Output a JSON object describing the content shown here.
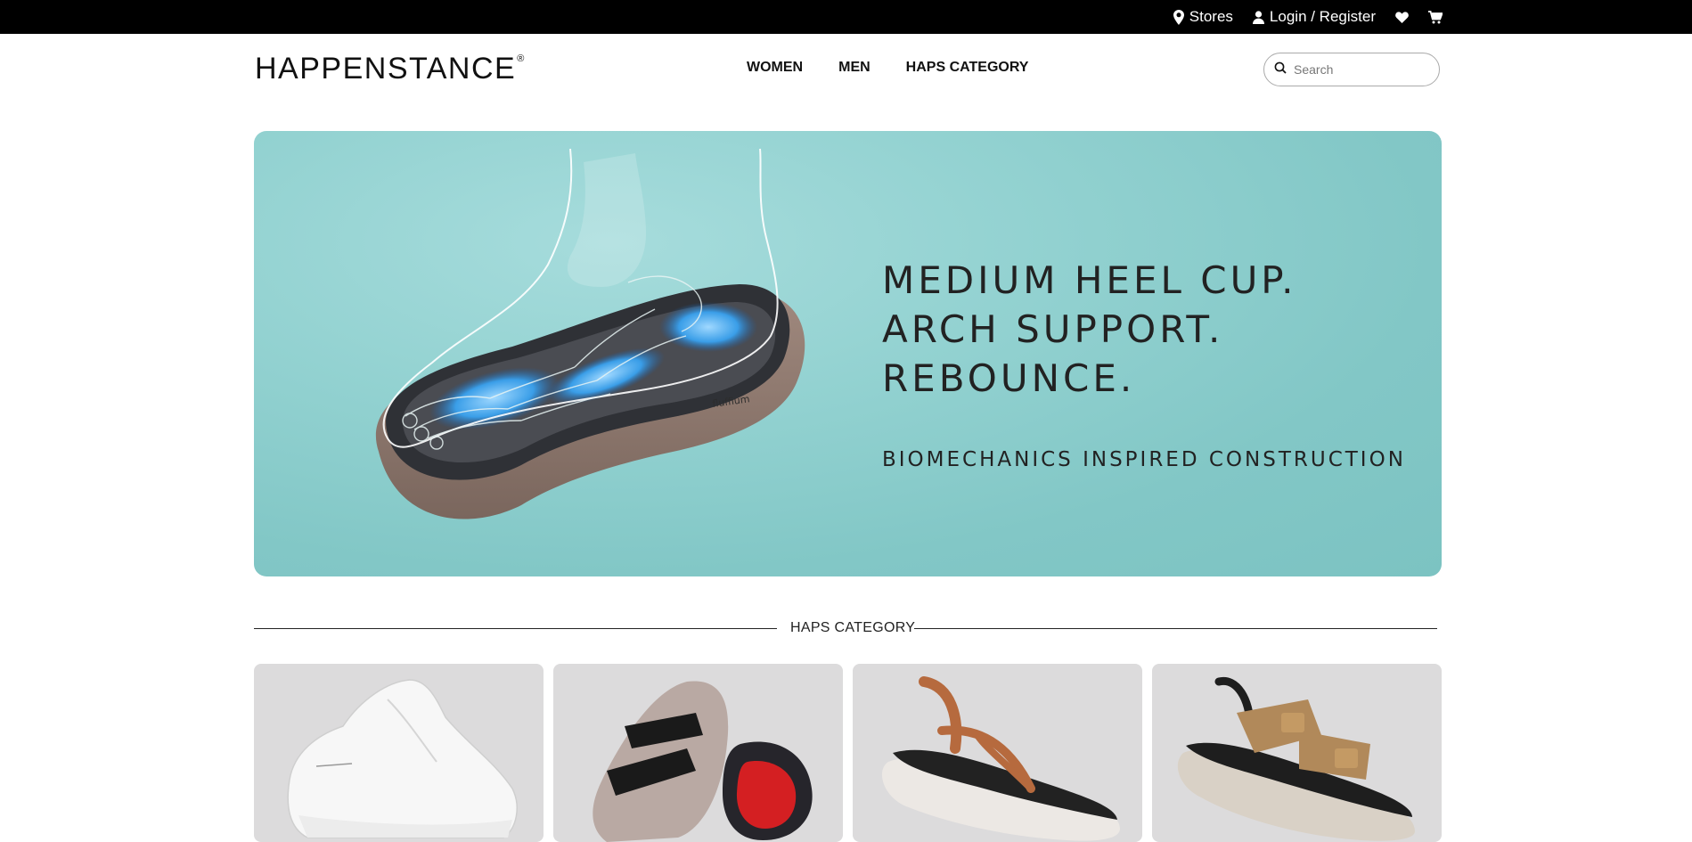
{
  "topbar": {
    "stores_label": "Stores",
    "login_label": "Login / Register"
  },
  "header": {
    "logo_text": "HAPPENSTANCE",
    "logo_mark": "®",
    "nav": [
      {
        "label": "WOMEN"
      },
      {
        "label": "MEN"
      },
      {
        "label": "HAPS CATEGORY"
      }
    ],
    "search": {
      "placeholder": "Search",
      "value": ""
    }
  },
  "banner": {
    "headline": "MEDIUM HEEL CUP.\nARCH SUPPORT.\nREBOUNCE.",
    "subline": "BIOMECHANICS INSPIRED CONSTRUCTION",
    "sole_brand": "fluffium"
  },
  "section": {
    "title": "HAPS CATEGORY"
  },
  "categories": [
    {
      "name": "sneaker"
    },
    {
      "name": "slide-sandal"
    },
    {
      "name": "thong-sandal"
    },
    {
      "name": "strap-sandal"
    }
  ],
  "colors": {
    "topbar_bg": "#000000",
    "banner_bg": "#8ccfce",
    "card_bg": "#dcdbdc",
    "accent_blue": "#3a9ee8"
  },
  "icons": [
    "location-pin-icon",
    "user-icon",
    "heart-icon",
    "cart-icon",
    "search-icon"
  ]
}
